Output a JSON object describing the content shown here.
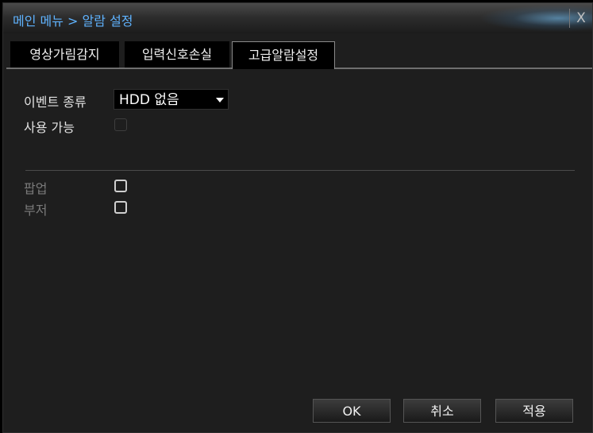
{
  "window": {
    "title": "메인 메뉴 > 알람 설정",
    "close_label": "X"
  },
  "tabs": [
    {
      "label": "영상가림감지",
      "active": false
    },
    {
      "label": "입력신호손실",
      "active": false
    },
    {
      "label": "고급알람설정",
      "active": true
    }
  ],
  "form": {
    "event_type_label": "이벤트 종류",
    "event_type_value": "HDD 없음",
    "enable_label": "사용 가능",
    "popup_label": "팝업",
    "buzzer_label": "부저"
  },
  "buttons": {
    "ok": "OK",
    "cancel": "취소",
    "apply": "적용"
  },
  "colors": {
    "title_text": "#5fb3ff",
    "background": "#1e1e1e"
  }
}
